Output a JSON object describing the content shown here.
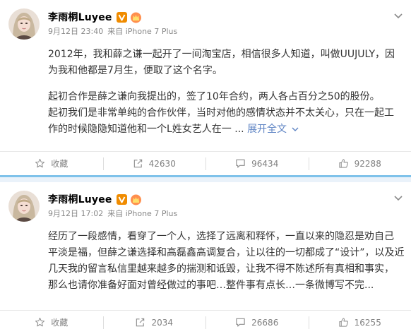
{
  "posts": [
    {
      "user": {
        "name": "李雨桐Luyee"
      },
      "date": "9月12日 23:40",
      "source": "来自 iPhone 7 Plus",
      "paragraphs": [
        "2012年，我和薛之谦一起开了一间淘宝店，相信很多人知道，叫做UUJULY，因",
        "为我和他都是7月生，便取了这个名字。",
        "起初合作是薛之谦向我提出的，签了10年合约，两人各占百分之50的股份。",
        "起初我们是非常单纯的合作伙伴，当时对他的感情状态并不太关心，只在一起工",
        "作的时候隐隐知道他和一个L姓女艺人在一 ..."
      ],
      "expand_label": "展开全文",
      "actions": {
        "favorite": "收藏",
        "repost": "42630",
        "comment": "96434",
        "like": "92288"
      }
    },
    {
      "user": {
        "name": "李雨桐Luyee"
      },
      "date": "9月12日 17:02",
      "source": "来自 iPhone 7 Plus",
      "paragraphs": [
        "经历了一段感情，看穿了一个人，选择了远离和释怀，一直以来的隐忍是劝自己",
        "平淡是福，但薛之谦选择和高磊鑫高调复合，让以往的一切都成了“设计”，以及近",
        "几天我的留言私信里越来越多的揣测和诋毁，让我不得不陈述所有真相和事实，",
        "那么也请你准备好面对曾经做过的事吧…整件事有点长…一条微博写不完..."
      ],
      "actions": {
        "favorite": "收藏",
        "repost": "2034",
        "comment": "26686",
        "like": "16255"
      }
    }
  ],
  "colors": {
    "link": "#5d83c3",
    "separator": "#7fc2ea",
    "verified": "#f08c00"
  },
  "icons": [
    "avatar",
    "verified-v-icon",
    "vip-crown-icon",
    "chevron-down-icon",
    "star-icon",
    "repost-icon",
    "comment-icon",
    "like-icon"
  ]
}
